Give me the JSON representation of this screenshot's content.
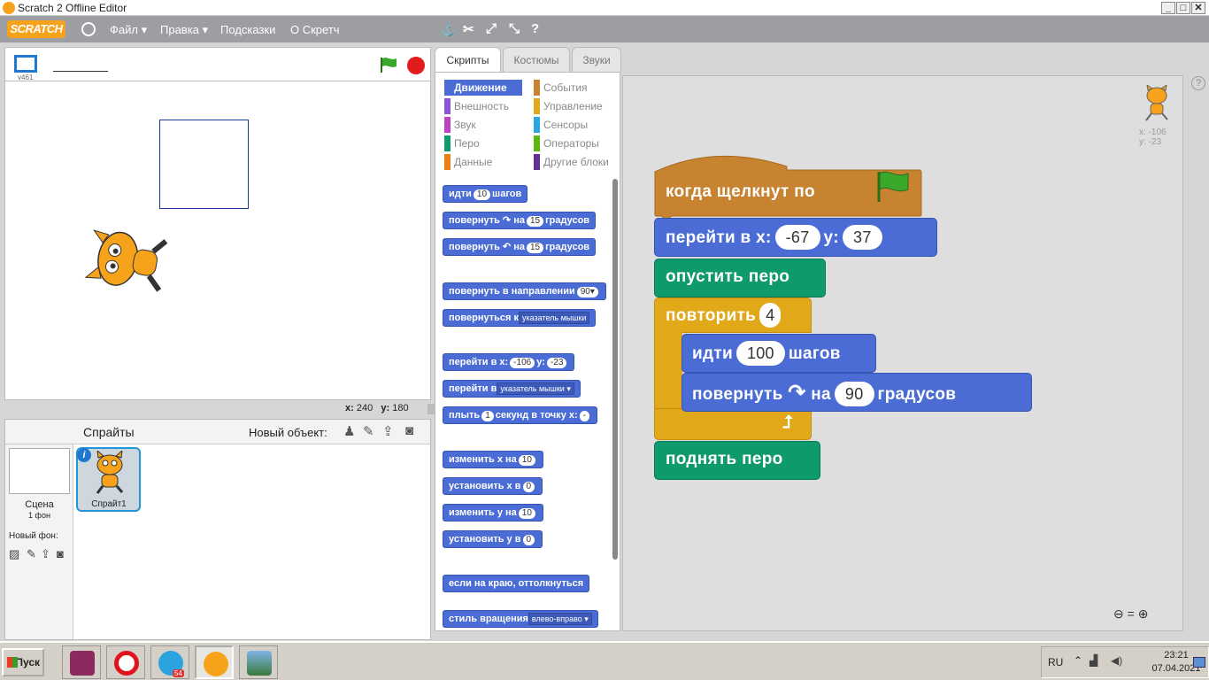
{
  "window": {
    "title": "Scratch 2 Offline Editor"
  },
  "menu": {
    "logo": "SCRATCH",
    "file": "Файл ▾",
    "edit": "Правка ▾",
    "tips": "Подсказки",
    "about": "О Скретч"
  },
  "stage": {
    "version": "v461",
    "coords": {
      "x_label": "x:",
      "x_value": "240",
      "y_label": "y:",
      "y_value": "180"
    }
  },
  "sprites": {
    "title": "Спрайты",
    "new_object": "Новый объект:",
    "stage_label": "Сцена",
    "stage_backdrops": "1 фон",
    "new_backdrop": "Новый фон:",
    "sprite1": "Спрайт1"
  },
  "tabs": [
    "Скрипты",
    "Костюмы",
    "Звуки"
  ],
  "categories": {
    "motion": "Движение",
    "looks": "Внешность",
    "sound": "Звук",
    "pen": "Перо",
    "data": "Данные",
    "events": "События",
    "control": "Управление",
    "sensing": "Сенсоры",
    "operators": "Операторы",
    "more": "Другие блоки"
  },
  "palette": {
    "move": {
      "a": "идти",
      "n": "10",
      "b": "шагов"
    },
    "turn_right": {
      "a": "повернуть ↷ на",
      "n": "15",
      "b": "градусов"
    },
    "turn_left": {
      "a": "повернуть ↶ на",
      "n": "15",
      "b": "градусов"
    },
    "point_dir": {
      "a": "повернуть в направлении",
      "n": "90▾"
    },
    "point_towards": {
      "a": "повернуться к",
      "d": "указатель мышки"
    },
    "goto_xy": {
      "a": "перейти в x:",
      "x": "-106",
      "b": "y:",
      "y": "-23"
    },
    "goto": {
      "a": "перейти в",
      "d": "указатель мышки ▾"
    },
    "glide": {
      "a": "плыть",
      "n": "1",
      "b": "секунд в точку x:",
      "x": "-"
    },
    "change_x": {
      "a": "изменить х на",
      "n": "10"
    },
    "set_x": {
      "a": "установить х в",
      "n": "0"
    },
    "change_y": {
      "a": "изменить y на",
      "n": "10"
    },
    "set_y": {
      "a": "установить y в",
      "n": "0"
    },
    "bounce": {
      "a": "если на краю, оттолкнуться"
    },
    "rotation": {
      "a": "стиль вращения",
      "d": "влево-вправо ▾"
    }
  },
  "script": {
    "hat": "когда щелкнут по",
    "goto": {
      "a": "перейти в x:",
      "x": "-67",
      "b": "y:",
      "y": "37"
    },
    "pen_down": "опустить перо",
    "repeat": {
      "a": "повторить",
      "n": "4"
    },
    "move": {
      "a": "идти",
      "n": "100",
      "b": "шагов"
    },
    "turn": {
      "a": "повернуть",
      "b": "на",
      "n": "90",
      "c": "градусов"
    },
    "pen_up": "поднять перо"
  },
  "sprite_info": {
    "x": "x: -106",
    "y": "y: -23"
  },
  "taskbar": {
    "start": "Пуск",
    "lang": "RU",
    "time": "23:21",
    "date": "07.04.2021",
    "badge": "54"
  },
  "colors": {
    "motion": "#4a6cd4",
    "events": "#c88330",
    "control": "#e1a91a",
    "pen": "#0e9a6c"
  }
}
